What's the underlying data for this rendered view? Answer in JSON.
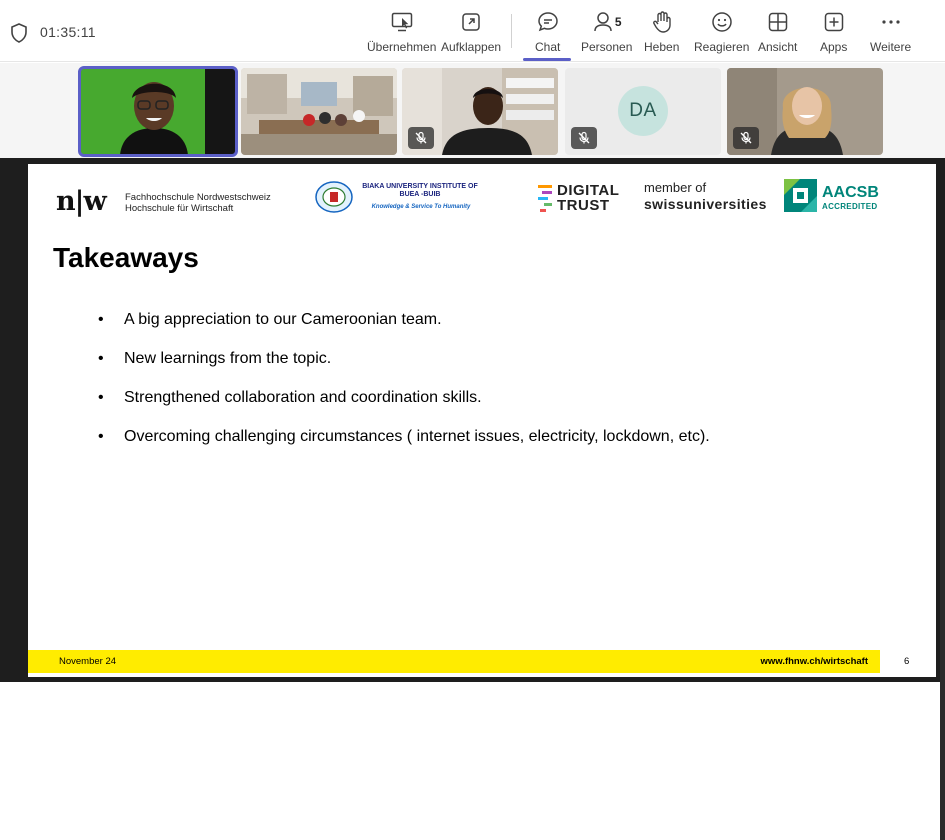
{
  "meeting": {
    "timer": "01:35:11"
  },
  "toolbar": {
    "items": [
      {
        "label": "Übernehmen",
        "icon": "share-control-icon"
      },
      {
        "label": "Aufklappen",
        "icon": "popout-icon"
      },
      {
        "label": "Chat",
        "icon": "chat-icon",
        "active": true
      },
      {
        "label": "Personen",
        "icon": "people-icon",
        "count": "5"
      },
      {
        "label": "Heben",
        "icon": "raise-hand-icon"
      },
      {
        "label": "Reagieren",
        "icon": "smile-icon"
      },
      {
        "label": "Ansicht",
        "icon": "grid-view-icon"
      },
      {
        "label": "Apps",
        "icon": "add-app-icon"
      },
      {
        "label": "Weitere",
        "icon": "more-icon"
      }
    ]
  },
  "participants": {
    "initials_tile": "DA"
  },
  "slide": {
    "logos": {
      "fhnw_mark": "n|w",
      "fhnw_line1": "Fachhochschule Nordwestschweiz",
      "fhnw_line2": "Hochschule für Wirtschaft",
      "biaka_line1": "BIAKA UNIVERSITY INSTITUTE OF",
      "biaka_line2": "BUEA -BUIB",
      "biaka_tagline": "Knowledge & Service To Humanity",
      "dt_line1": "DIGITAL",
      "dt_line2": "TRUST",
      "member_line1": "member of",
      "member_line2": "swissuniversities",
      "aacsb_line1": "AACSB",
      "aacsb_line2": "ACCREDITED"
    },
    "title": "Takeaways",
    "bullets": [
      "A big appreciation to our Cameroonian team.",
      "New learnings from the topic.",
      "Strengthened collaboration and coordination skills.",
      "Overcoming challenging circumstances ( internet issues, electricity, lockdown, etc)."
    ],
    "footer_date": "November 24",
    "footer_url": "www.fhnw.ch/wirtschaft",
    "page_number": "6"
  },
  "colors": {
    "accent": "#5b5fc7",
    "footer_yellow": "#ffec00",
    "aacsb_teal": "#00857a"
  }
}
